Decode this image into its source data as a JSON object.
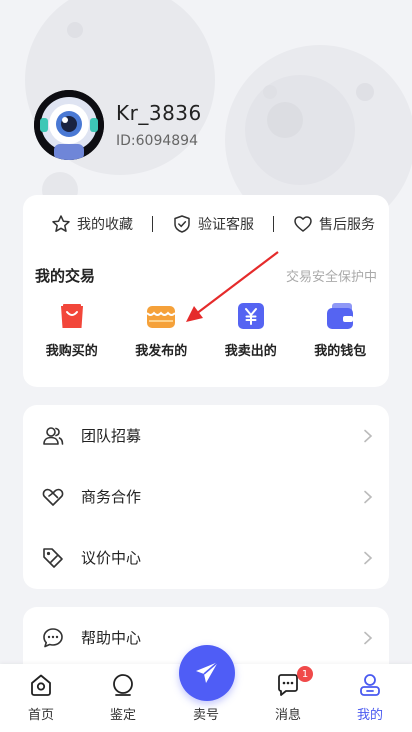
{
  "profile": {
    "name": "Kr_3836",
    "id_text": "ID:6094894"
  },
  "quick_links": [
    {
      "label": "我的收藏",
      "icon": "star-icon"
    },
    {
      "label": "验证客服",
      "icon": "shield-check-icon"
    },
    {
      "label": "售后服务",
      "icon": "heart-icon"
    }
  ],
  "trade": {
    "title": "我的交易",
    "subtitle": "交易安全保护中",
    "items": [
      {
        "label": "我购买的",
        "icon": "shopping-bag-icon",
        "color": "#f2463a"
      },
      {
        "label": "我发布的",
        "icon": "store-icon",
        "color": "#f5a13a"
      },
      {
        "label": "我卖出的",
        "icon": "yuan-icon",
        "color": "#5564f2"
      },
      {
        "label": "我的钱包",
        "icon": "wallet-icon",
        "color": "#5564f2"
      }
    ]
  },
  "menu": [
    {
      "label": "团队招募",
      "icon": "team-icon"
    },
    {
      "label": "商务合作",
      "icon": "handshake-icon"
    },
    {
      "label": "议价中心",
      "icon": "price-tag-icon"
    }
  ],
  "menu2": [
    {
      "label": "帮助中心",
      "icon": "chat-help-icon"
    }
  ],
  "tabs": [
    {
      "label": "首页",
      "icon": "home-icon"
    },
    {
      "label": "鉴定",
      "icon": "appraise-icon"
    },
    {
      "label": "卖号",
      "icon": "send-icon"
    },
    {
      "label": "消息",
      "icon": "message-icon",
      "badge": "1"
    },
    {
      "label": "我的",
      "icon": "user-icon",
      "active": true
    }
  ],
  "colors": {
    "accent": "#4f5df6",
    "badge": "#f04a4a",
    "arrow": "#e52b2b"
  }
}
